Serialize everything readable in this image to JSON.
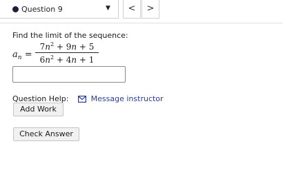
{
  "header": {
    "question_label": "Question 9",
    "dropdown_caret": "▼",
    "prev_label": "<",
    "next_label": ">"
  },
  "question": {
    "prompt": "Find the limit of the sequence:",
    "sequence_var": "a",
    "sequence_subscript": "n",
    "equals": "=",
    "numerator": {
      "coef1": "7",
      "var1": "n",
      "exp1": "2",
      "op1": " + ",
      "coef2": "9",
      "var2": "n",
      "op2": " + ",
      "const": "5"
    },
    "denominator": {
      "coef1": "6",
      "var1": "n",
      "exp1": "2",
      "op1": " + ",
      "coef2": "4",
      "var2": "n",
      "op2": " + ",
      "const": "1"
    },
    "answer_value": ""
  },
  "help": {
    "label": "Question Help:",
    "message_link": "Message instructor"
  },
  "buttons": {
    "add_work": "Add Work",
    "check_answer": "Check Answer"
  },
  "colors": {
    "link": "#2b3c99",
    "status_dot": "#1b1f3b"
  }
}
